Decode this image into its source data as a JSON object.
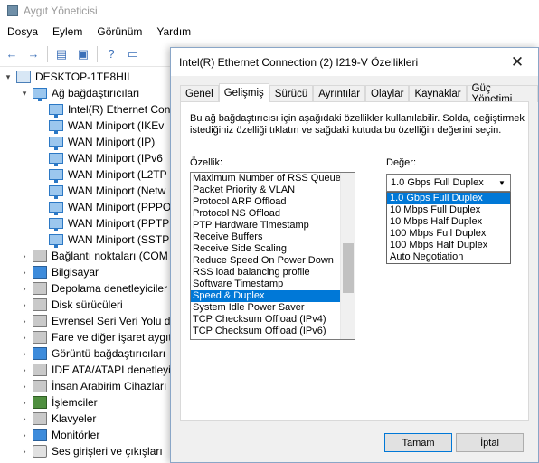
{
  "device_manager": {
    "title": "Aygıt Yöneticisi",
    "menu": [
      "Dosya",
      "Eylem",
      "Görünüm",
      "Yardım"
    ],
    "toolbar_icons": [
      "back-icon",
      "forward-icon",
      "properties-icon",
      "refresh-icon",
      "help-icon",
      "scan-icon"
    ],
    "tree": [
      {
        "label": "DESKTOP-1TF8HII",
        "level": 0,
        "expander": "▾",
        "icon": "computer"
      },
      {
        "label": "Ağ bağdaştırıcıları",
        "level": 1,
        "expander": "▾",
        "icon": "net"
      },
      {
        "label": "Intel(R) Ethernet Con",
        "level": 2,
        "expander": "",
        "icon": "net"
      },
      {
        "label": "WAN Miniport (IKEv",
        "level": 2,
        "expander": "",
        "icon": "net"
      },
      {
        "label": "WAN Miniport (IP)",
        "level": 2,
        "expander": "",
        "icon": "net"
      },
      {
        "label": "WAN Miniport (IPv6",
        "level": 2,
        "expander": "",
        "icon": "net"
      },
      {
        "label": "WAN Miniport (L2TP",
        "level": 2,
        "expander": "",
        "icon": "net"
      },
      {
        "label": "WAN Miniport (Netw",
        "level": 2,
        "expander": "",
        "icon": "net"
      },
      {
        "label": "WAN Miniport (PPPO",
        "level": 2,
        "expander": "",
        "icon": "net"
      },
      {
        "label": "WAN Miniport (PPTP",
        "level": 2,
        "expander": "",
        "icon": "net"
      },
      {
        "label": "WAN Miniport (SSTP",
        "level": 2,
        "expander": "",
        "icon": "net"
      },
      {
        "label": "Bağlantı noktaları (COM",
        "level": 1,
        "expander": "›",
        "icon": "generic"
      },
      {
        "label": "Bilgisayar",
        "level": 1,
        "expander": "›",
        "icon": "monitor"
      },
      {
        "label": "Depolama denetleyiciler",
        "level": 1,
        "expander": "›",
        "icon": "generic"
      },
      {
        "label": "Disk sürücüleri",
        "level": 1,
        "expander": "›",
        "icon": "generic"
      },
      {
        "label": "Evrensel Seri Veri Yolu de",
        "level": 1,
        "expander": "›",
        "icon": "generic"
      },
      {
        "label": "Fare ve diğer işaret aygıt",
        "level": 1,
        "expander": "›",
        "icon": "generic"
      },
      {
        "label": "Görüntü bağdaştırıcıları",
        "level": 1,
        "expander": "›",
        "icon": "monitor"
      },
      {
        "label": "IDE ATA/ATAPI denetleyi",
        "level": 1,
        "expander": "›",
        "icon": "generic"
      },
      {
        "label": "İnsan Arabirim Cihazları",
        "level": 1,
        "expander": "›",
        "icon": "generic"
      },
      {
        "label": "İşlemciler",
        "level": 1,
        "expander": "›",
        "icon": "chip"
      },
      {
        "label": "Klavyeler",
        "level": 1,
        "expander": "›",
        "icon": "generic"
      },
      {
        "label": "Monitörler",
        "level": 1,
        "expander": "›",
        "icon": "monitor"
      },
      {
        "label": "Ses girişleri ve çıkışları",
        "level": 1,
        "expander": "›",
        "icon": "audio"
      }
    ]
  },
  "dialog": {
    "title": "Intel(R) Ethernet Connection (2) I219-V Özellikleri",
    "tabs": [
      {
        "label": "Genel",
        "active": false
      },
      {
        "label": "Gelişmiş",
        "active": true
      },
      {
        "label": "Sürücü",
        "active": false
      },
      {
        "label": "Ayrıntılar",
        "active": false
      },
      {
        "label": "Olaylar",
        "active": false
      },
      {
        "label": "Kaynaklar",
        "active": false
      },
      {
        "label": "Güç Yönetimi",
        "active": false
      }
    ],
    "description": "Bu ağ bağdaştırıcısı için aşağıdaki özellikler kullanılabilir. Solda, değiştirmek istediğiniz özelliği tıklatın ve sağdaki kutuda bu özelliğin değerini seçin.",
    "property_label": "Özellik:",
    "value_label": "Değer:",
    "properties": [
      "Maximum Number of RSS Queues",
      "Packet Priority & VLAN",
      "Protocol ARP Offload",
      "Protocol NS Offload",
      "PTP Hardware Timestamp",
      "Receive Buffers",
      "Receive Side Scaling",
      "Reduce Speed On Power Down",
      "RSS load balancing profile",
      "Software Timestamp",
      "Speed & Duplex",
      "System Idle Power Saver",
      "TCP Checksum Offload (IPv4)",
      "TCP Checksum Offload (IPv6)"
    ],
    "selected_property_index": 10,
    "value_current": "1.0 Gbps Full Duplex",
    "value_options": [
      "1.0 Gbps Full Duplex",
      "10 Mbps Full Duplex",
      "10 Mbps Half Duplex",
      "100 Mbps Full Duplex",
      "100 Mbps Half Duplex",
      "Auto Negotiation"
    ],
    "selected_value_index": 0,
    "ok_label": "Tamam",
    "cancel_label": "İptal",
    "colors": {
      "selection": "#0078d7",
      "ok_border": "#0078d7"
    }
  }
}
